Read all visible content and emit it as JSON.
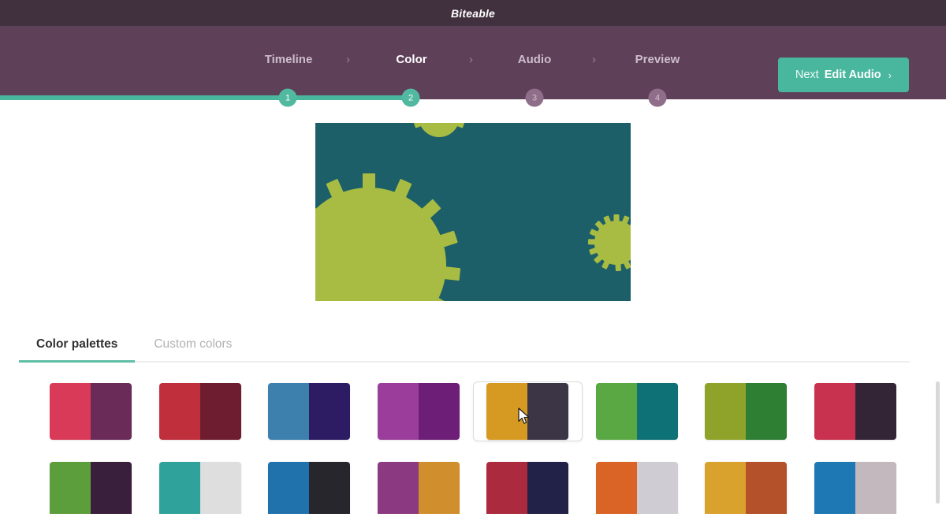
{
  "app": {
    "brand": "Biteable"
  },
  "header": {
    "steps": [
      {
        "label": "Timeline",
        "state": "done"
      },
      {
        "label": "Color",
        "state": "active"
      },
      {
        "label": "Audio",
        "state": "todo"
      },
      {
        "label": "Preview",
        "state": "todo"
      }
    ],
    "separator": "›",
    "next_button": {
      "prefix": "Next",
      "label": "Edit Audio",
      "arrow": "›",
      "color": "#49b79e"
    },
    "progress": {
      "markers": [
        "1",
        "2",
        "3",
        "4"
      ],
      "completed_count": 2,
      "fill_color": "#49b79e",
      "pending_color": "#8e6e89"
    },
    "bar_color": "#5e4059",
    "titlebar_color": "#41303d"
  },
  "preview": {
    "background": "#1d5f68",
    "gear_color": "#a8bc43",
    "alt": "gears-animation-preview"
  },
  "tabs": [
    {
      "label": "Color palettes",
      "active": true
    },
    {
      "label": "Custom colors",
      "active": false
    }
  ],
  "palettes": [
    {
      "id": "p1",
      "left": "#d83a58",
      "right": "#6b2b58",
      "selected": false
    },
    {
      "id": "p2",
      "left": "#bf2f3c",
      "right": "#6e1c2f",
      "selected": false
    },
    {
      "id": "p3",
      "left": "#3d7fad",
      "right": "#2d1c63",
      "selected": false
    },
    {
      "id": "p4",
      "left": "#9b3e9b",
      "right": "#6d1f78",
      "selected": false
    },
    {
      "id": "p5",
      "left": "#d69a22",
      "right": "#3c3546",
      "selected": true
    },
    {
      "id": "p6",
      "left": "#5aa844",
      "right": "#0e7176",
      "selected": false
    },
    {
      "id": "p7",
      "left": "#8fa32a",
      "right": "#2e7e34",
      "selected": false
    },
    {
      "id": "p8",
      "left": "#c9324e",
      "right": "#332535",
      "selected": false
    },
    {
      "id": "p9",
      "left": "#5d9e3c",
      "right": "#3a1f3c",
      "selected": false
    },
    {
      "id": "p10",
      "left": "#2fa39b",
      "right": "#dedede",
      "selected": false
    },
    {
      "id": "p11",
      "left": "#1f72ac",
      "right": "#28262d",
      "selected": false
    },
    {
      "id": "p12",
      "left": "#8b3a82",
      "right": "#d08f2c",
      "selected": false
    },
    {
      "id": "p13",
      "left": "#ac2a3e",
      "right": "#222249",
      "selected": false
    },
    {
      "id": "p14",
      "left": "#da6326",
      "right": "#cfcdd3",
      "selected": false
    },
    {
      "id": "p15",
      "left": "#d9a22c",
      "right": "#b4512a",
      "selected": false
    },
    {
      "id": "p16",
      "left": "#1d78b3",
      "right": "#c4b8bf",
      "selected": false
    }
  ]
}
